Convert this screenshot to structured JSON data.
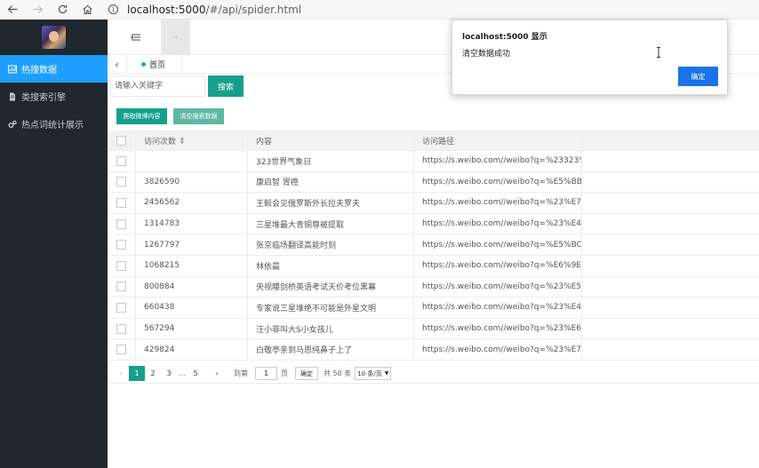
{
  "browser": {
    "url_host": "localhost:5000",
    "url_path": "/#/api/spider.html"
  },
  "sidebar": {
    "items": [
      {
        "label": "热搜数据",
        "icon": "chart-icon",
        "active": true
      },
      {
        "label": "类搜索引擎",
        "icon": "document-icon",
        "active": false
      },
      {
        "label": "热点词统计展示",
        "icon": "gears-icon",
        "active": false
      }
    ]
  },
  "topbar": {
    "tab_label": "··"
  },
  "tabs": {
    "home_label": "首页"
  },
  "search": {
    "placeholder": "请输入关键字",
    "button_label": "搜索"
  },
  "actions": {
    "crawl_label": "爬取微博内容",
    "clear_label": "清空搜索数据"
  },
  "table": {
    "headers": [
      "访问次数",
      "内容",
      "访问路径"
    ],
    "rows": [
      {
        "visits": "",
        "content": "323世界气象日",
        "url": "https://s.weibo.com//weibo?q=%23323%..."
      },
      {
        "visits": "3826590",
        "content": "康启智 胃癌",
        "url": "https://s.weibo.com//weibo?q=%E5%BB..."
      },
      {
        "visits": "2456562",
        "content": "王毅会见俄罗斯外长拉夫罗夫",
        "url": "https://s.weibo.com//weibo?q=%23%E7..."
      },
      {
        "visits": "1314783",
        "content": "三星堆最大青铜尊被提取",
        "url": "https://s.weibo.com//weibo?q=%23%E4..."
      },
      {
        "visits": "1267797",
        "content": "张京临场翻译高能时刻",
        "url": "https://s.weibo.com//weibo?q=%E5%BC..."
      },
      {
        "visits": "1068215",
        "content": "林依晨",
        "url": "https://s.weibo.com//weibo?q=%E6%9E..."
      },
      {
        "visits": "800884",
        "content": "央视曝剑桥英语考试天价考位黑幕",
        "url": "https://s.weibo.com//weibo?q=%23%E5..."
      },
      {
        "visits": "660438",
        "content": "专家说三星堆绝不可能是外星文明",
        "url": "https://s.weibo.com//weibo?q=%23%E4..."
      },
      {
        "visits": "567294",
        "content": "汪小菲叫大S小女孩儿",
        "url": "https://s.weibo.com//weibo?q=%23%E6..."
      },
      {
        "visits": "429824",
        "content": "白敬亭亲到马思纯鼻子上了",
        "url": "https://s.weibo.com//weibo?q=%23%E7..."
      }
    ]
  },
  "pager": {
    "pages": [
      "1",
      "2",
      "3"
    ],
    "ellipsis": "…",
    "last_page": "5",
    "goto_label": "到第",
    "goto_value": "1",
    "page_unit": "页",
    "confirm_label": "确定",
    "total_label": "共 50 条",
    "per_page_label": "10 条/页"
  },
  "alert": {
    "title": "localhost:5000 显示",
    "message": "清空数据成功",
    "ok_label": "确定"
  },
  "colors": {
    "sidebar_bg": "#21272e",
    "sidebar_active": "#1e9fff",
    "primary_green": "#16a08a",
    "dialog_button": "#1a73e8"
  }
}
